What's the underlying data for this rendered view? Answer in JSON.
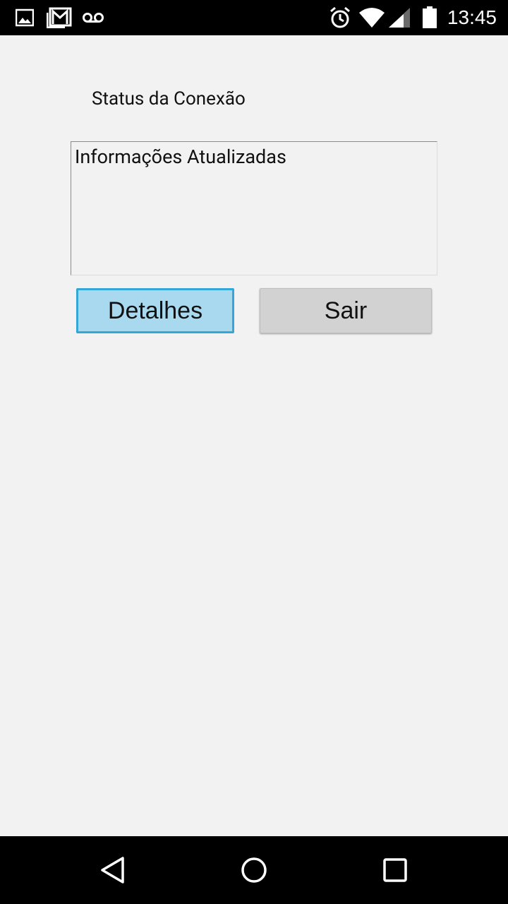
{
  "status_bar": {
    "time": "13:45",
    "icons": [
      "image-notification-icon",
      "gmail-icon",
      "voicemail-icon",
      "alarm-icon",
      "wifi-icon",
      "cell-signal-icon",
      "battery-icon"
    ]
  },
  "screen": {
    "title": "Status da Conexão",
    "info_text": "Informações Atualizadas"
  },
  "buttons": {
    "details_label": "Detalhes",
    "exit_label": "Sair"
  },
  "nav_bar": {
    "icons": [
      "back-icon",
      "home-icon",
      "recents-icon"
    ]
  },
  "colors": {
    "background": "#f2f2f2",
    "details_button_bg": "#a8d9ef",
    "details_button_border": "#35a7d6",
    "exit_button_bg": "#d2d2d2"
  }
}
